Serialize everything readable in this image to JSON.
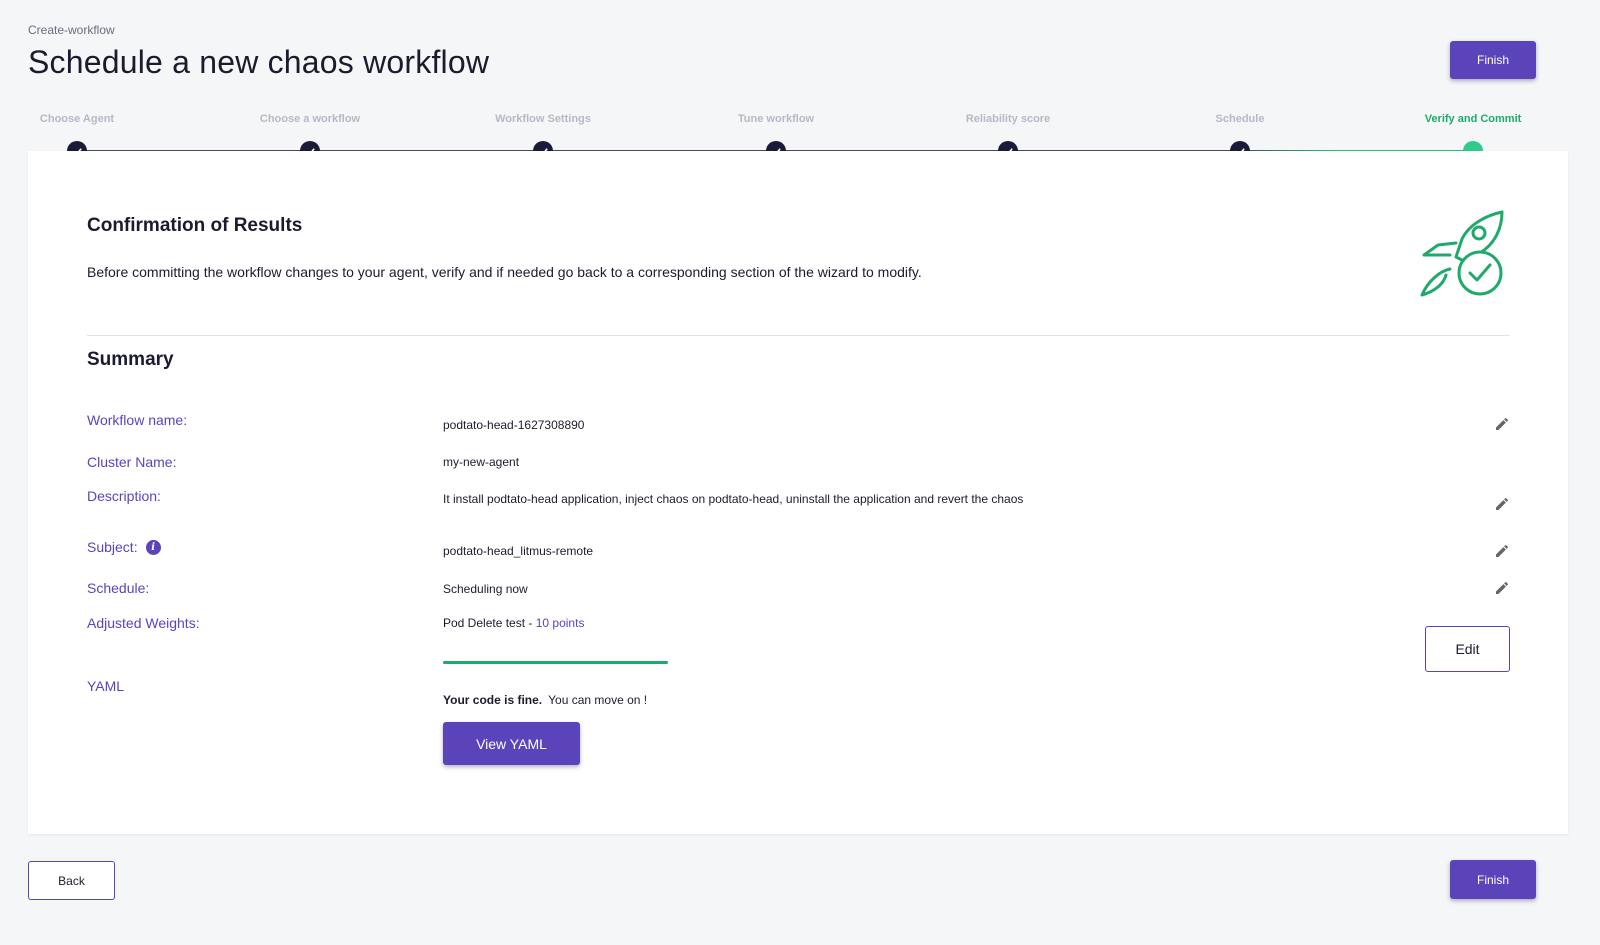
{
  "breadcrumb": "Create-workflow",
  "title": "Schedule a new chaos workflow",
  "actions": {
    "finish_label": "Finish",
    "back_label": "Back"
  },
  "stepper": {
    "steps": [
      {
        "label": "Choose Agent",
        "status": "done"
      },
      {
        "label": "Choose a workflow",
        "status": "done"
      },
      {
        "label": "Workflow Settings",
        "status": "done"
      },
      {
        "label": "Tune workflow",
        "status": "done"
      },
      {
        "label": "Reliability score",
        "status": "done"
      },
      {
        "label": "Schedule",
        "status": "done"
      },
      {
        "label": "Verify and Commit",
        "status": "active"
      }
    ]
  },
  "confirmation": {
    "title": "Confirmation of Results",
    "description": "Before committing the workflow changes to your agent, verify and if needed go back to a corresponding section of the wizard to modify."
  },
  "summary": {
    "title": "Summary",
    "workflow_name": {
      "label": "Workflow name:",
      "value": "podtato-head-1627308890"
    },
    "cluster_name": {
      "label": "Cluster Name:",
      "value": "my-new-agent"
    },
    "description": {
      "label": "Description:",
      "value": "It install podtato-head application, inject chaos on podtato-head, uninstall the application  and revert the chaos"
    },
    "subject": {
      "label": "Subject:",
      "value": "podtato-head_litmus-remote"
    },
    "schedule": {
      "label": "Schedule:",
      "value": "Scheduling now"
    },
    "weights": {
      "label": "Adjusted Weights:",
      "test": "Pod Delete test",
      "separator": " - ",
      "points": "10 points",
      "edit_label": "Edit"
    },
    "yaml": {
      "label": "YAML",
      "status_bold": "Your code is fine.",
      "status_text": "You can move on !",
      "button_label": "View YAML"
    }
  },
  "colors": {
    "accent": "#5b44ba",
    "success": "#1faa6b",
    "dark": "#1b1b38"
  },
  "icons": {
    "edit": "pencil-icon",
    "info": "info-icon",
    "check": "check-icon",
    "illustration": "rocket-check-icon"
  }
}
